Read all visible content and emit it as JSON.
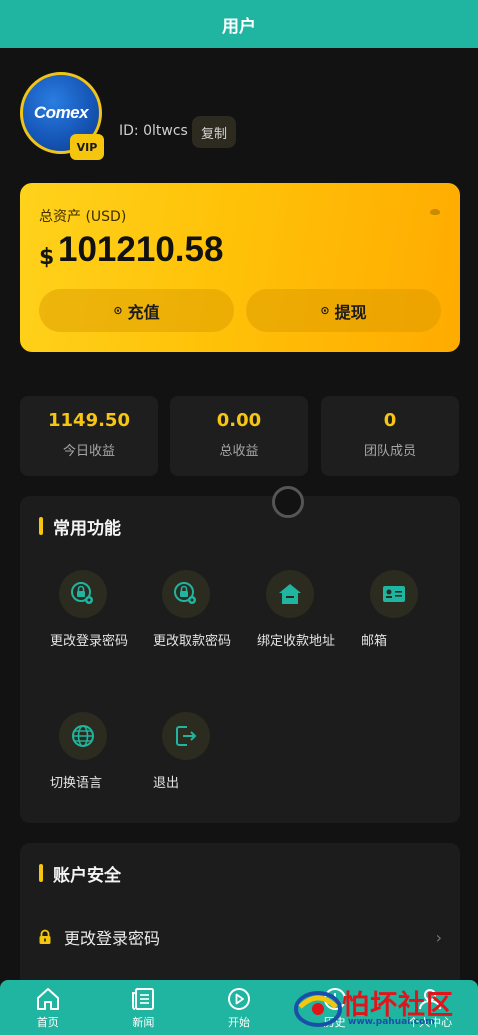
{
  "header": {
    "title": "用户"
  },
  "profile": {
    "avatar_text": "Comex",
    "vip_label": "VIP",
    "id_text": "ID: 0ltwcs",
    "copy_label": "复制"
  },
  "assets": {
    "label": "总资产 (USD)",
    "currency_symbol": "$",
    "amount": "101210.58",
    "recharge_label": "充值",
    "withdraw_label": "提现"
  },
  "stats": [
    {
      "value": "1149.50",
      "label": "今日收益"
    },
    {
      "value": "0.00",
      "label": "总收益"
    },
    {
      "value": "0",
      "label": "团队成员"
    }
  ],
  "functions": {
    "title": "常用功能",
    "items": [
      {
        "label": "更改登录密码",
        "icon": "lock-gear-icon"
      },
      {
        "label": "更改取款密码",
        "icon": "lock-gear-icon"
      },
      {
        "label": "绑定收款地址",
        "icon": "house-icon"
      },
      {
        "label": "邮箱",
        "icon": "id-card-icon"
      },
      {
        "label": "切换语言",
        "icon": "globe-icon"
      },
      {
        "label": "退出",
        "icon": "logout-icon"
      }
    ]
  },
  "security": {
    "title": "账户安全",
    "rows": [
      {
        "label": "更改登录密码",
        "icon": "lock-icon"
      }
    ]
  },
  "tabbar": {
    "items": [
      {
        "label": "首页",
        "icon": "home-icon"
      },
      {
        "label": "新闻",
        "icon": "news-icon"
      },
      {
        "label": "开始",
        "icon": "play-icon"
      },
      {
        "label": "历史",
        "icon": "history-icon"
      },
      {
        "label": "个人中心",
        "icon": "user-icon"
      }
    ]
  },
  "watermark": {
    "text": "怕坏社区",
    "sub": "www.pahuai.com"
  },
  "colors": {
    "header_bg": "#1fb5a0",
    "accent_yellow": "#f5c60d",
    "page_bg": "#121212",
    "card_bg": "#1c1c1c",
    "icon_teal": "#1fb5a0"
  }
}
